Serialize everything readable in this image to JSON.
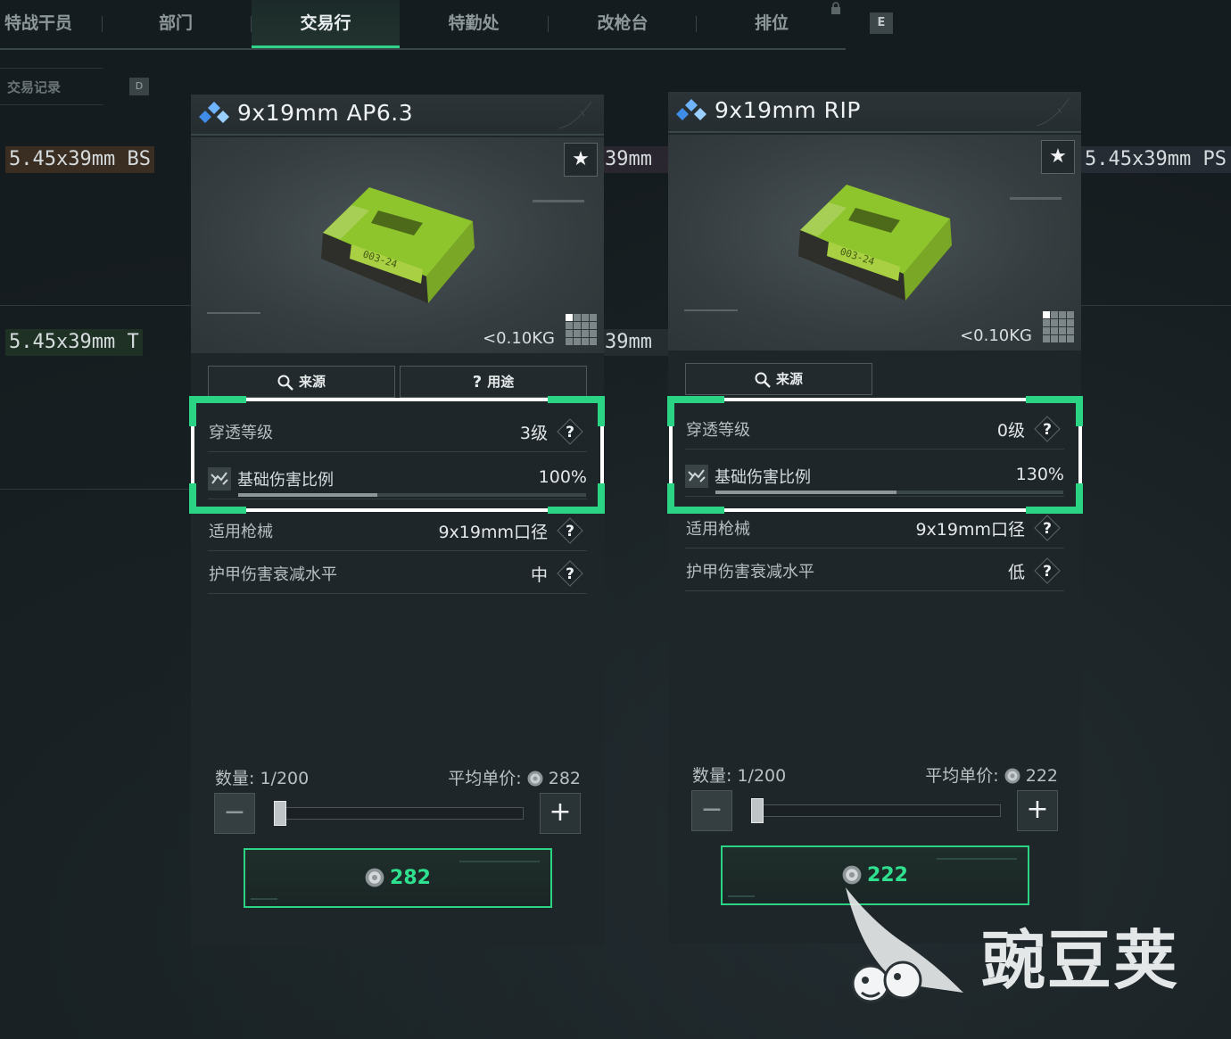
{
  "nav": {
    "tabs": [
      "特战干员",
      "部门",
      "交易行",
      "特勤处",
      "改枪台",
      "排位"
    ],
    "active_tab": "交易行",
    "key_hint": "E"
  },
  "subnav": {
    "label": "交易记录",
    "key_hint": "D"
  },
  "background_items": [
    {
      "label": "5.45x39mm BS",
      "color": "#b98a5c"
    },
    {
      "label": "39mm",
      "color": "#8e7fa8"
    },
    {
      "label": "5.45x39mm PS",
      "color": "#7f8ea0"
    },
    {
      "label": "5.45x39mm T",
      "color": "#6fa27a"
    },
    {
      "label": "39mm",
      "color": "#8a9498"
    }
  ],
  "cards": [
    {
      "title": "9x19mm AP6.3",
      "weight": "<0.10KG",
      "buttons": {
        "source": "来源",
        "usage": "用途"
      },
      "stats": {
        "penetration": {
          "label": "穿透等级",
          "value": "3级"
        },
        "damage": {
          "label": "基础伤害比例",
          "value": "100%",
          "fill": 0.4
        },
        "weapon": {
          "label": "适用枪械",
          "value": "9x19mm口径"
        },
        "armor": {
          "label": "护甲伤害衰减水平",
          "value": "中"
        }
      },
      "quantity": {
        "label": "数量:",
        "value": "1/200"
      },
      "avg_price": {
        "label": "平均单价:",
        "value": "282"
      },
      "buy_price": "282"
    },
    {
      "title": "9x19mm RIP",
      "weight": "<0.10KG",
      "buttons": {
        "source": "来源"
      },
      "stats": {
        "penetration": {
          "label": "穿透等级",
          "value": "0级"
        },
        "damage": {
          "label": "基础伤害比例",
          "value": "130%",
          "fill": 0.52
        },
        "weapon": {
          "label": "适用枪械",
          "value": "9x19mm口径"
        },
        "armor": {
          "label": "护甲伤害衰减水平",
          "value": "低"
        }
      },
      "quantity": {
        "label": "数量:",
        "value": "1/200"
      },
      "avg_price": {
        "label": "平均单价:",
        "value": "222"
      },
      "buy_price": "222"
    }
  ],
  "watermark": {
    "text": "豌豆荚"
  },
  "colors": {
    "accent": "#2bd485",
    "highlight_frame": "#ffffff",
    "background": "#151c1f"
  }
}
